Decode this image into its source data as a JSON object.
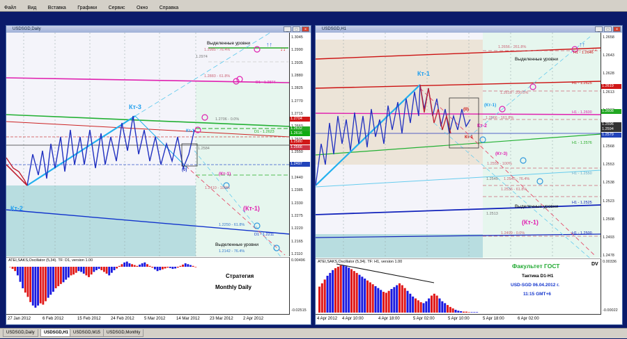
{
  "menu": [
    "Файл",
    "Вид",
    "Вставка",
    "Графики",
    "Сервис",
    "Окно",
    "Справка"
  ],
  "left": {
    "title": "USDSGD,Daily",
    "price_axis": [
      "1.3045",
      "1.2990",
      "1.2935",
      "1.2880",
      "1.2825",
      "1.2770",
      "1.2715",
      "1.2660",
      "1.2605",
      "1.2550",
      "1.2495",
      "1.2440",
      "1.2385",
      "1.2330",
      "1.2275",
      "1.2220",
      "1.2165",
      "1.2110"
    ],
    "price_tags": [
      {
        "text": "1.2704",
        "color": "#d01818"
      },
      {
        "text": "1.2632",
        "color": "#22a822"
      },
      {
        "text": "1.2616",
        "color": "#11aa11"
      },
      {
        "text": "1.2580",
        "color": "#d01818"
      },
      {
        "text": "1.2566",
        "color": "#cc3344"
      },
      {
        "text": "1.2497",
        "color": "#2244bb"
      }
    ],
    "levels": [
      {
        "text": "1.2985 - 76.4%"
      },
      {
        "text": "1.2974"
      },
      {
        "text": "1.2883 - 61.8%"
      },
      {
        "text": "D1 - 1.2874"
      },
      {
        "text": "1.2706 - 0.0%"
      },
      {
        "text": "D1 - 1.2623"
      },
      {
        "text": "1.2584"
      },
      {
        "text": "1.2410 - 100%"
      },
      {
        "text": "1.2250 - 61.8%"
      },
      {
        "text": "D1 - 1.2211"
      },
      {
        "text": "1.2142 - 76.4%"
      }
    ],
    "annotations": {
      "kt3": "Кт-3",
      "kt1_small": "Кт-1",
      "kt2": "Кт-2",
      "zero": "(0)",
      "kt1_paren": "(Кт-1)",
      "kt1_big": "(Кт-1)",
      "highlighted_top": "Выделенные уровни",
      "highlighted_bottom": "Выделенные уровни"
    },
    "osc": {
      "label": "ATEI,SAKS,Oscillator (5,34). TF: D1, version 1.00",
      "axis_top": "0.00496",
      "axis_bottom": "-0.02515",
      "strategy_line1": "Стратегия",
      "strategy_line2": "Monthly Daily",
      "bars": [
        0.0,
        -0.05,
        -0.1,
        -0.2,
        -0.35,
        -0.5,
        -0.6,
        -0.7,
        -0.82,
        -0.9,
        -0.95,
        -0.9,
        -0.85,
        -0.88,
        -0.8,
        -0.72,
        -0.65,
        -0.58,
        -0.5,
        -0.45,
        -0.4,
        -0.36,
        -0.3,
        -0.25,
        -0.2,
        -0.18,
        -0.14,
        -0.1,
        -0.12,
        -0.16,
        -0.2,
        -0.24,
        -0.18,
        -0.12,
        -0.08,
        -0.05,
        -0.08,
        -0.12,
        -0.16,
        -0.2,
        -0.14,
        -0.08,
        -0.04,
        0.02,
        0.06,
        0.1,
        0.12,
        0.08,
        0.06,
        0.04,
        0.02,
        0.05,
        0.08,
        0.1,
        0.06,
        0.02,
        -0.02,
        -0.06,
        -0.1,
        -0.08,
        -0.06,
        -0.04,
        -0.02,
        -0.03,
        -0.05,
        -0.04,
        -0.02,
        0.02,
        0.05,
        0.08,
        0.06,
        0.04,
        0.02,
        -0.01
      ]
    },
    "dates": [
      "27 Jan 2012",
      "6 Feb 2012",
      "15 Feb 2012",
      "24 Feb 2012",
      "5 Mar 2012",
      "14 Mar 2012",
      "23 Mar 2012",
      "2 Apr 2012"
    ]
  },
  "right": {
    "title": "USDSGD,H1",
    "price_axis": [
      "1.2658",
      "1.2643",
      "1.2628",
      "1.2613",
      "1.2598",
      "1.2583",
      "1.2568",
      "1.2553",
      "1.2538",
      "1.2523",
      "1.2508",
      "1.2493",
      "1.2478"
    ],
    "price_tags": [
      {
        "text": "1.2619",
        "color": "#d01818"
      },
      {
        "text": "1.2608",
        "color": "#22a822"
      },
      {
        "text": "1.2596",
        "color": "#333333"
      },
      {
        "text": "1.2594",
        "color": "#333333"
      },
      {
        "text": "1.2579",
        "color": "#2244bb"
      }
    ],
    "levels": [
      {
        "text": "1.2656 - 261.8%"
      },
      {
        "text": "H1 - 1.2646"
      },
      {
        "text": "H1 - 1.2625"
      },
      {
        "text": "1.2619 - 200.0%"
      },
      {
        "text": "H1 - 1.2600"
      },
      {
        "text": "1.2566 - 161.8%"
      },
      {
        "text": "H1 - 1.2576"
      },
      {
        "text": "1.2559 - 100%"
      },
      {
        "text": "H1 - 1.2550"
      },
      {
        "text": "1.2545"
      },
      {
        "text": "1.2545 - 76.4%"
      },
      {
        "text": "1.2536 - 61.8%"
      },
      {
        "text": "H1 - 1.2525"
      },
      {
        "text": "1.2513"
      },
      {
        "text": "1.2499 - 0.0%"
      },
      {
        "text": "H1 - 1.2500"
      }
    ],
    "annotations": {
      "kt1_top": "Кт-1",
      "zero": "(0)",
      "kt1_paren": "(Кт-1)",
      "kt2": "Кт-2",
      "kt1_red": "Кт-1",
      "kt3": "(Кт-3)",
      "kt1_big": "(Кт-1)",
      "highlighted_top": "Выделенные уровни",
      "highlighted_bottom": "Выделенные уровни"
    },
    "osc": {
      "label": "ATEI,SAKS,Oscillator (5,34). TF: H1, version 1.00",
      "axis_top": "0.00336",
      "axis_bottom": "-0.00022",
      "dv": "DV",
      "info1": "Факультет ГОСТ",
      "info2": "Тактика D1-H1",
      "info3": "USD-SGD  06.04.2012 г.",
      "info4": "11:15  GMT+6",
      "bars": [
        0.55,
        0.62,
        0.7,
        0.78,
        0.84,
        0.9,
        0.94,
        0.97,
        1.0,
        1.0,
        0.98,
        0.95,
        0.92,
        0.88,
        0.84,
        0.8,
        0.76,
        0.72,
        0.68,
        0.64,
        0.6,
        0.56,
        0.52,
        0.48,
        0.44,
        0.42,
        0.46,
        0.5,
        0.54,
        0.58,
        0.62,
        0.58,
        0.52,
        0.46,
        0.4,
        0.34,
        0.3,
        0.26,
        0.22,
        0.2,
        0.24,
        0.3,
        0.36,
        0.4,
        0.36,
        0.3,
        0.24,
        0.2,
        0.16,
        0.12,
        0.09,
        0.06,
        0.04,
        0.03,
        0.02,
        0.02,
        0.01,
        0.01,
        0.01,
        0.01
      ]
    },
    "dates": [
      "4 Apr 2012",
      "4 Apr 10:00",
      "4 Apr 18:00",
      "5 Apr 02:00",
      "5 Apr 10:00",
      "5 Apr 18:00",
      "6 Apr 02:00"
    ]
  },
  "tabs": [
    "USDSGD,Daily",
    "USDSGD,H1",
    "USDSGD,M15",
    "USDSGD,Monthly"
  ],
  "active_tab": 1
}
